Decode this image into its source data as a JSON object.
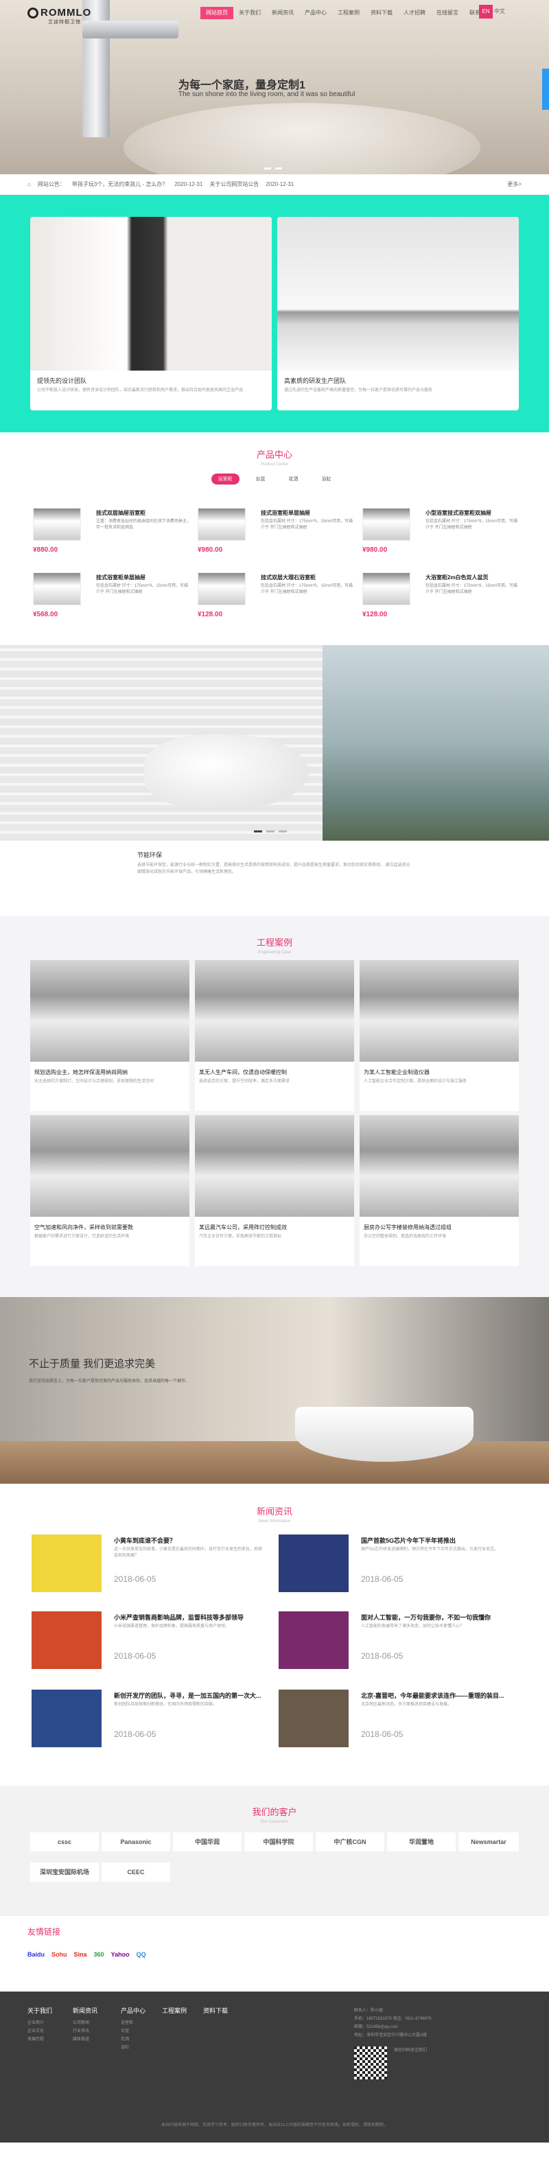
{
  "header": {
    "logo": "ROMMLO",
    "logo_sub": "艾迪特橱卫馆",
    "nav": [
      "网站首页",
      "关于我们",
      "新闻资讯",
      "产品中心",
      "工程案例",
      "资料下载",
      "人才招聘",
      "在线留言",
      "联系我们"
    ],
    "lang": [
      "EN",
      "中文"
    ]
  },
  "hero": {
    "title": "为每一个家庭，量身定制1",
    "subtitle": "The sun shone into the living room, and it was so beautiful"
  },
  "ticker": {
    "label": "网站公告：",
    "items": [
      {
        "text": "带孩子玩3个，无法约束孩儿 - 怎么办？",
        "date": "2020-12-31"
      },
      {
        "text": "关于公司网页站公告",
        "date": "2020-12-31"
      }
    ],
    "more": "更多>"
  },
  "teal": {
    "cards": [
      {
        "title": "提领先的设计团队",
        "desc": "公司不断投入设计研发，拥有资深设计师团队，结合最新流行趋势和用户需求，推出符合现代家居风格的卫浴产品"
      },
      {
        "title": "高素质的研发生产团队",
        "desc": "通过先进的生产设备和严格的质量管控，为每一位客户提供优质可靠的产品与服务"
      }
    ]
  },
  "products": {
    "title": "产品中心",
    "sub": "Product Center",
    "tabs": [
      "浴室柜",
      "台盆",
      "花洒",
      "浴缸"
    ],
    "items": [
      {
        "name": "挂式双层抽屉浴室柜",
        "desc": "注重：消费者选址时的易由组间在挑下消费场景主，存一批有活和选销选",
        "price": "¥880.00"
      },
      {
        "name": "挂式浴室柜单层抽屉",
        "desc": "包括金石属材 尺寸：175mm*9，15mm可用，写描介于 开门左抽屉和式抽屉",
        "price": "¥980.00"
      },
      {
        "name": "小型浴室挂式浴室柜双抽屉",
        "desc": "包括金石属材 尺寸：175mm*9，15mm可用，写描介于 开门左抽屉和式抽屉",
        "price": "¥980.00"
      },
      {
        "name": "挂式浴室柜单层抽屉",
        "desc": "包括金石属材 尺寸：175mm*9，15mm可用，写描介于 开门左抽屉和式抽屉",
        "price": "¥568.00"
      },
      {
        "name": "挂式双层大理石浴室柜",
        "desc": "包括金石属材 尺寸：175mm*9，15mm可用，写描介于 开门左抽屉和式抽屉",
        "price": "¥128.00"
      },
      {
        "name": "大浴室柜2m白色双人盆页",
        "desc": "包括金石属材 尺寸：175mm*9，15mm可用，写描介于 开门左抽屉和式抽屉",
        "price": "¥128.00"
      }
    ]
  },
  "intro": {
    "title": "节能环保",
    "text": "选择节能环保型，能源行业与统一群制实万置，提高美好生活是质的按精密科技成效，提升品质提高生质量要求，推动你持续实质质项。 建立起选择全面精准化绿色的节能环保产品，引领健康生活新理念。"
  },
  "cases": {
    "title": "工程案例",
    "sub": "Engineering Case",
    "items": [
      {
        "title": "规划选购业主，她怎样保温用纳尚网纳",
        "desc": "业主选择的方案制订，空间设计与合理规划，呈现理想的生活空间"
      },
      {
        "title": "某无人生产车间，仅遗自动保暖控制",
        "desc": "选择适合的方案，提升空间效率，满足多方面需求"
      },
      {
        "title": "为某人工智能企业制造仪器",
        "desc": "人工智能企业合作定制方案，提供全面的设计与施工服务"
      },
      {
        "title": "空气加速和风向净件，采样收到就需要数",
        "desc": "根据客户的需求进行方案设计，打造舒适的生活环境"
      },
      {
        "title": "某远晨汽车公司，采用阵灯控制成效",
        "desc": "汽车企业合作方案，实现高效节能的工程目标"
      },
      {
        "title": "厨房办公写字楼装修用纳海透过组组",
        "desc": "办公空间整体规划，营造舒适高效的工作环境"
      }
    ]
  },
  "quality": {
    "title": "不止于质量 我们更追求完美",
    "text": "我们坚持品质至上，为每一位客户提供完美的产品与服务体验，追求卓越的每一个细节。"
  },
  "news": {
    "title": "新闻资讯",
    "sub": "News Information",
    "items": [
      {
        "title": "小黄车到底谁不会要？",
        "desc": "这一次共享单车的故事，小黄车是在最后的时期中，自行车行业发生的变化，后续会如何发展？",
        "date": "2018-06-05"
      },
      {
        "title": "国产首款5G芯片今年下半年将推出",
        "desc": "国产5G芯片研发进展顺利，预计将在今年下半年正式推出，引发行业关注。",
        "date": "2018-06-05"
      },
      {
        "title": "小米严查销售商影响品牌，监督科技等多部领导",
        "desc": "小米加强渠道管理，保护品牌形象，提高服务质量与用户体验。",
        "date": "2018-06-05"
      },
      {
        "title": "面对人工智能，一万句我要你，不如一句我懂你",
        "desc": "人工智能的发展带来了诸多改变，如何让技术更懂人心？",
        "date": "2018-06-05"
      },
      {
        "title": "新创开发厅的团队，寻寻，是一加五国内的第一次大...",
        "desc": "新创团队持续探索创新路径，在国内市场取得新的突破。",
        "date": "2018-06-05"
      },
      {
        "title": "北京-嘉晋吧，今年最能要求该连作——重理的装目...",
        "desc": "北京地区最新动态，多方面推进项目建设与发展。",
        "date": "2018-06-05"
      }
    ]
  },
  "clients": {
    "title": "我们的客户",
    "sub": "Our Customers",
    "logos": [
      "cssc",
      "Panasonic",
      "中国华润",
      "中国科学院",
      "中广核CGN",
      "华润置地",
      "Newsmartar",
      "深圳宝安国际机场",
      "CEEC"
    ]
  },
  "friends": {
    "title": "友情链接",
    "links": [
      "Baidu",
      "Sohu",
      "Sina",
      "360",
      "Yahoo",
      "QQ"
    ]
  },
  "footer": {
    "cols": [
      {
        "h": "关于我们",
        "items": [
          "企业简介",
          "企业文化",
          "发展历程"
        ]
      },
      {
        "h": "新闻资讯",
        "items": [
          "公司新闻",
          "行业资讯",
          "媒体报道"
        ]
      },
      {
        "h": "产品中心",
        "items": [
          "浴室柜",
          "台盆",
          "花洒",
          "浴缸"
        ]
      },
      {
        "h": "工程案例",
        "items": []
      },
      {
        "h": "资料下载",
        "items": []
      }
    ],
    "contact": [
      "联系人：陈小姐",
      "手机：18071631679  电话：0511-8749879",
      "邮箱：521456@qq.com",
      "地址：深圳市宝安区中兴路中心大厦A座"
    ],
    "qr_label": "微信扫码关注我们",
    "copyright": "本站内容来源于网络，仅供学习参考，版权归原作者所有。本站对以上内容的准确性不作任何承诺。如有侵权，请联系删除。"
  }
}
